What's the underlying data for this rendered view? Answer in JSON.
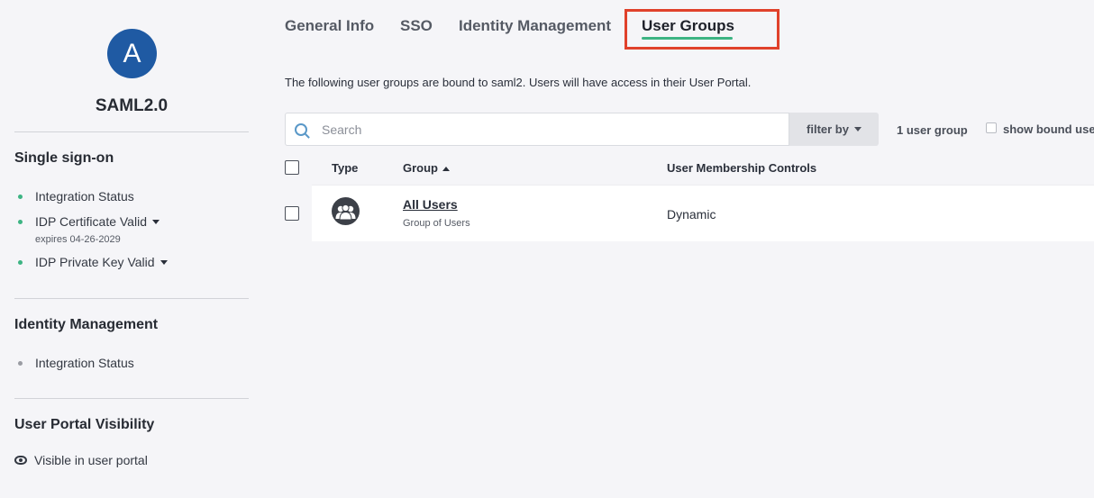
{
  "sidebar": {
    "avatar_letter": "A",
    "app_name": "SAML2.0",
    "sso": {
      "title": "Single sign-on",
      "items": [
        {
          "label": "Integration Status",
          "status": "green"
        },
        {
          "label": "IDP Certificate Valid",
          "status": "green",
          "note": "expires 04-26-2029"
        },
        {
          "label": "IDP Private Key Valid",
          "status": "green"
        }
      ]
    },
    "identity": {
      "title": "Identity Management",
      "items": [
        {
          "label": "Integration Status",
          "status": "gray"
        }
      ]
    },
    "portal": {
      "title": "User Portal Visibility",
      "visible_label": "Visible in user portal"
    }
  },
  "tabs": [
    {
      "label": "General Info",
      "active": false
    },
    {
      "label": "SSO",
      "active": false
    },
    {
      "label": "Identity Management",
      "active": false
    },
    {
      "label": "User Groups",
      "active": true
    }
  ],
  "main": {
    "intro": "The following user groups are bound to saml2. Users will have access in their User Portal.",
    "search_placeholder": "Search",
    "filter_label": "filter by",
    "group_count": "1 user group",
    "show_bound_label": "show bound use",
    "columns": {
      "type": "Type",
      "group": "Group",
      "membership": "User Membership Controls"
    },
    "rows": [
      {
        "icon": "users-group-icon",
        "name": "All Users",
        "sub": "Group of Users",
        "membership": "Dynamic"
      }
    ]
  },
  "colors": {
    "accent_green": "#3db483",
    "avatar_blue": "#1f5aa3",
    "highlight_red": "#e0412b"
  }
}
